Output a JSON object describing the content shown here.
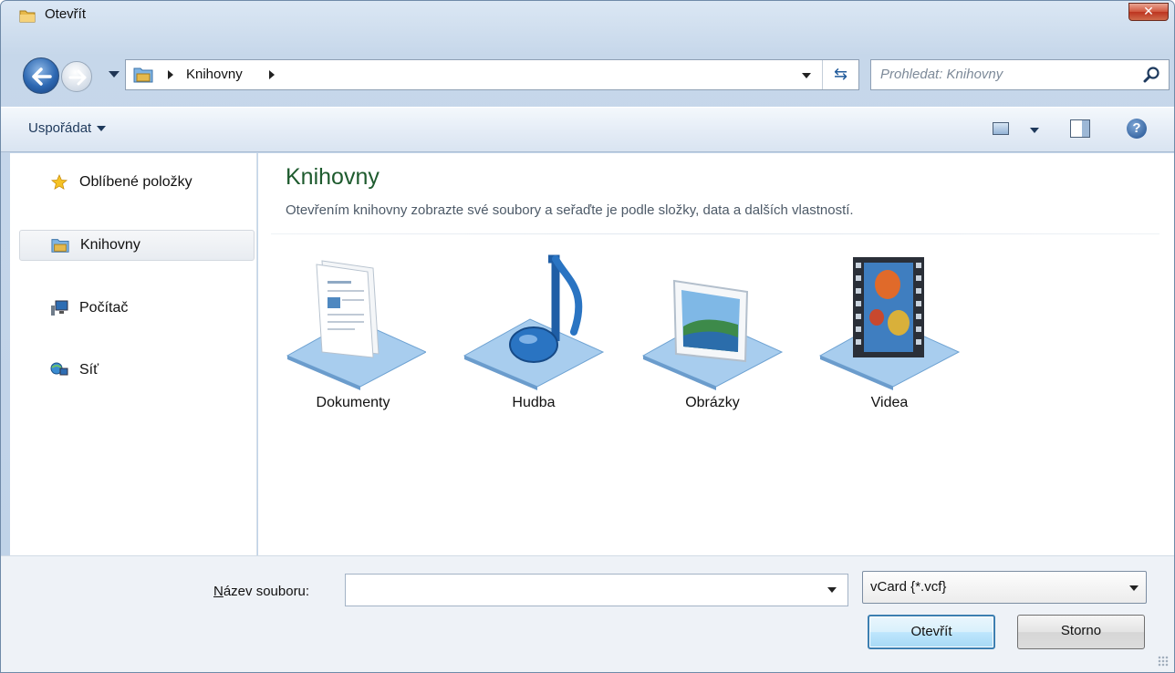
{
  "window": {
    "title": "Otevřít",
    "close_glyph": "✕"
  },
  "nav": {
    "breadcrumb": "Knihovny",
    "refresh_glyph": "⇆",
    "search_placeholder": "Prohledat: Knihovny"
  },
  "toolbar": {
    "organize_label": "Uspořádat",
    "help_glyph": "?"
  },
  "sidebar": {
    "items": [
      {
        "label": "Oblíbené položky",
        "icon": "star-icon",
        "selected": false
      },
      {
        "label": "Knihovny",
        "icon": "libraries-icon",
        "selected": true
      },
      {
        "label": "Počítač",
        "icon": "computer-icon",
        "selected": false
      },
      {
        "label": "Síť",
        "icon": "network-icon",
        "selected": false
      }
    ]
  },
  "main": {
    "title": "Knihovny",
    "description": "Otevřením knihovny zobrazte své soubory a seřaďte je podle složky, data a dalších vlastností.",
    "libraries": [
      {
        "label": "Dokumenty",
        "icon": "documents-library-icon"
      },
      {
        "label": "Hudba",
        "icon": "music-library-icon"
      },
      {
        "label": "Obrázky",
        "icon": "pictures-library-icon"
      },
      {
        "label": "Videa",
        "icon": "videos-library-icon"
      }
    ]
  },
  "footer": {
    "filename_label_accel": "N",
    "filename_label_rest": "ázev souboru:",
    "filename_value": "",
    "filetype_value": "vCard {*.vcf}",
    "open_button": "Otevřít",
    "cancel_button": "Storno"
  },
  "colors": {
    "title_green": "#1e5b2e",
    "accent_blue": "#3c7fb1",
    "close_red": "#c4412a"
  }
}
